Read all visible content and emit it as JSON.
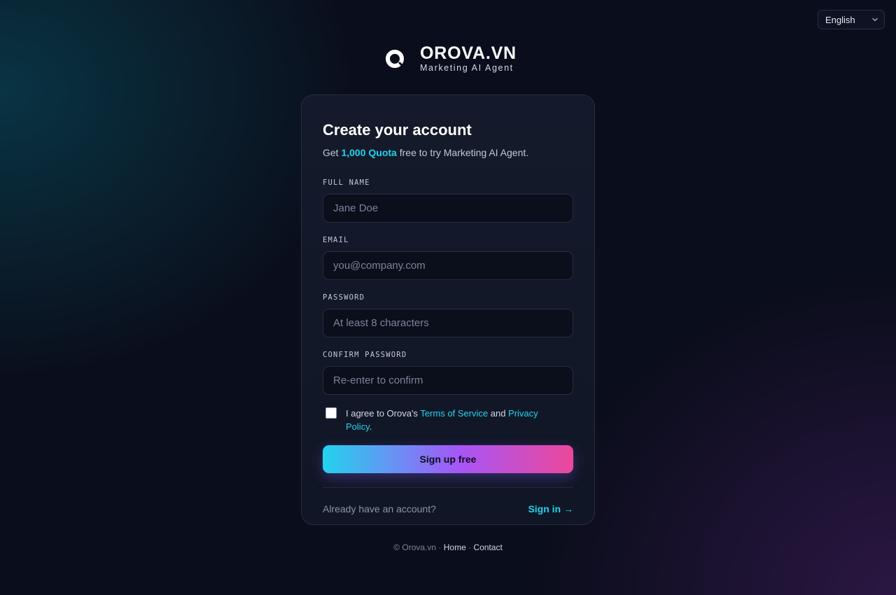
{
  "language_selector": {
    "value": "English",
    "icon": "chevron-down-icon"
  },
  "brand": {
    "name": "OROVA.VN",
    "tagline": "Marketing AI Agent",
    "logo_icon": "orova-ring-logo"
  },
  "form": {
    "title": "Create your account",
    "subtitle_prefix": "Get ",
    "subtitle_highlight": "1,000 Quota",
    "subtitle_suffix": " free to try Marketing AI Agent.",
    "fields": {
      "full_name": {
        "label": "FULL NAME",
        "placeholder": "Jane Doe",
        "value": ""
      },
      "email": {
        "label": "EMAIL",
        "placeholder": "you@company.com",
        "value": ""
      },
      "password": {
        "label": "PASSWORD",
        "placeholder": "At least 8 characters",
        "value": ""
      },
      "confirm_password": {
        "label": "CONFIRM PASSWORD",
        "placeholder": "Re-enter to confirm",
        "value": ""
      }
    },
    "agreement": {
      "checked": false,
      "prefix": "I agree to Orova's ",
      "terms_link": "Terms of Service",
      "middle": " and ",
      "privacy_link": "Privacy Policy",
      "suffix": "."
    },
    "submit_label": "Sign up free",
    "already_text": "Already have an account?",
    "signin_label": "Sign in →"
  },
  "footer": {
    "copyright": "© Orova.vn · ",
    "home": "Home",
    "separator": " · ",
    "contact": "Contact"
  },
  "colors": {
    "accent": "#22d3ee",
    "gradient_start": "#22d3ee",
    "gradient_mid": "#a855f7",
    "gradient_end": "#ec4899",
    "background": "#0a0d1b"
  }
}
